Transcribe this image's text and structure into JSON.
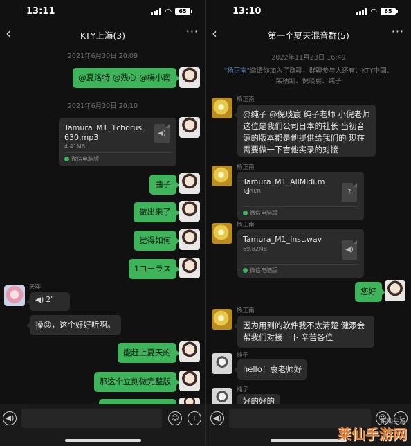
{
  "colors": {
    "bubble_self": "#3eb55a",
    "bubble_other": "#2b2b2b",
    "background": "#111111",
    "link": "#5a7eb0"
  },
  "left": {
    "status": {
      "time": "13:11",
      "battery": "65"
    },
    "nav": {
      "back_icon": "chevron-left-icon",
      "title": "KTY上海(3)",
      "more_icon": "more-dots-icon"
    },
    "messages": [
      {
        "kind": "timestamp",
        "text": "2021年6月30日 20:09"
      },
      {
        "kind": "text",
        "side": "right",
        "text": "@夏洛特 @残心 @楊小南"
      },
      {
        "kind": "timestamp",
        "text": "2021年6月30日 20:10"
      },
      {
        "kind": "file",
        "side": "right",
        "name": "Tamura_M1_1chorus_630.mp3",
        "size": "4.41MB",
        "source": "微信电脑版"
      },
      {
        "kind": "text",
        "side": "right",
        "text": "曲子"
      },
      {
        "kind": "text",
        "side": "right",
        "text": "做出来了"
      },
      {
        "kind": "text",
        "side": "right",
        "text": "觉得如何"
      },
      {
        "kind": "text",
        "side": "right",
        "text": "1コーラス"
      },
      {
        "kind": "voice",
        "side": "left",
        "sender": "天奕",
        "duration": "2\""
      },
      {
        "kind": "text",
        "side": "left",
        "text": "操😡，这个好好听啊。"
      },
      {
        "kind": "text",
        "side": "right",
        "text": "能赶上夏天的"
      },
      {
        "kind": "text",
        "side": "right",
        "text": "那这个立刻做完整版"
      }
    ]
  },
  "right": {
    "status": {
      "time": "13:10",
      "battery": "65"
    },
    "nav": {
      "back_icon": "chevron-left-icon",
      "title": "第一个夏天混音群(5)",
      "more_icon": "more-dots-icon"
    },
    "timestamp": "2022年11月23日 16:49",
    "system": {
      "inviter": "\"杨正南\"",
      "text": "邀请你加入了群聊，群聊参与人还有：KTY中国、柴柄凯、倪琰宸、纯子"
    },
    "messages": [
      {
        "kind": "text",
        "side": "left",
        "sender": "杨正南",
        "text": "@纯子 @倪琰宸 纯子老师 小倪老师 这位是我们公司日本的社长 当初音源的版本都是他提供给我们的 现在需要做一下吉他实录的对接"
      },
      {
        "kind": "file",
        "side": "left",
        "sender": "杨正南",
        "name": "Tamura_M1_AllMidi.mid",
        "size": "103KB",
        "source": "微信电脑版",
        "icon": "?"
      },
      {
        "kind": "file",
        "side": "left",
        "sender": "杨正南",
        "name": "Tamura_M1_Inst.wav",
        "size": "69.82MB",
        "source": "微信电脑版",
        "icon": "◀)"
      },
      {
        "kind": "text",
        "side": "right",
        "text": "您好"
      },
      {
        "kind": "text",
        "side": "left",
        "sender": "杨正南",
        "text": "因为用到的软件我不太清楚 健添会帮我们对接一下 辛苦各位"
      },
      {
        "kind": "text",
        "side": "left",
        "sender": "纯子",
        "text": "hello！袁老师好"
      },
      {
        "kind": "text",
        "side": "left",
        "sender": "纯子",
        "text": "好的好的"
      }
    ]
  },
  "input_bar": {
    "voice_icon": "voice-icon",
    "emoji_icon": "emoji-icon",
    "plus_icon": "plus-icon"
  },
  "watermark": {
    "main": "莱仙手游网",
    "sub": "莱仙手游"
  }
}
